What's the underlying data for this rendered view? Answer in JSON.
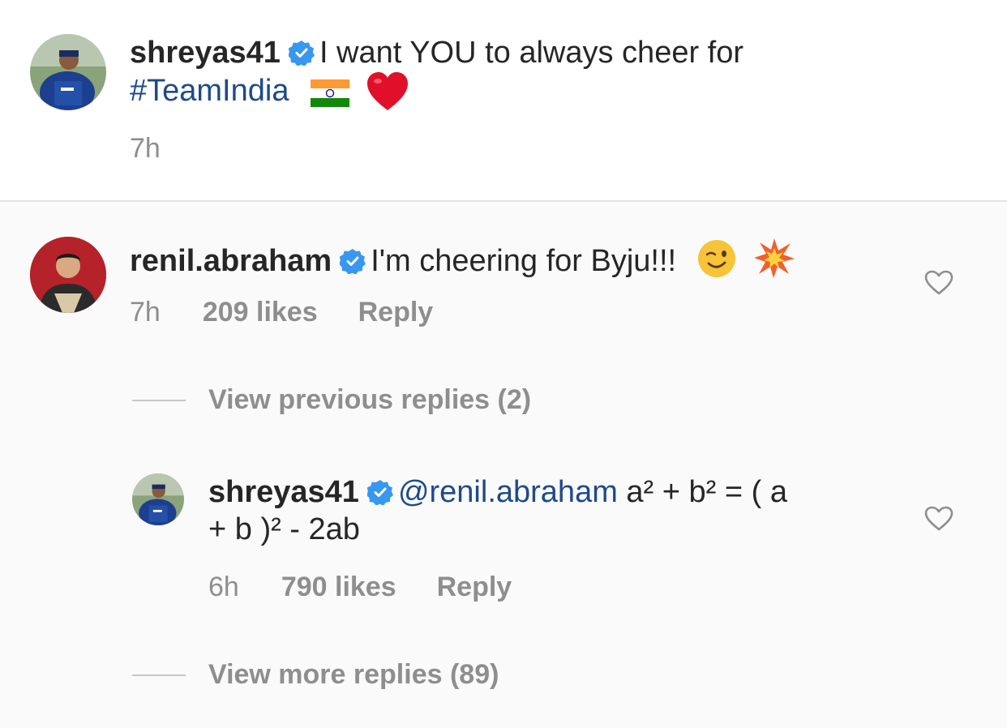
{
  "caption": {
    "username": "shreyas41",
    "text": "I want YOU to always cheer for",
    "hashtag": "#TeamIndia",
    "time": "7h"
  },
  "comments": [
    {
      "username": "renil.abraham",
      "text": "I'm cheering for Byju!!!",
      "time": "7h",
      "likes": "209 likes",
      "reply_label": "Reply"
    }
  ],
  "view_previous": "View previous replies (2)",
  "reply": {
    "username": "shreyas41",
    "mention": "@renil.abraham",
    "text_line1": "a² + b² = ( a",
    "text_line2": "+ b )² - 2ab",
    "time": "6h",
    "likes": "790 likes",
    "reply_label": "Reply"
  },
  "view_more": "View more replies (89)",
  "icons": {
    "verified": "verified-badge-icon",
    "heart": "heart-outline-icon",
    "flag": "india-flag-emoji",
    "red_heart": "red-heart-emoji",
    "wink": "winking-face-emoji",
    "collision": "collision-emoji"
  },
  "colors": {
    "link": "#1e4a8a",
    "verified": "#3897f0",
    "muted": "#8e8e8e"
  }
}
